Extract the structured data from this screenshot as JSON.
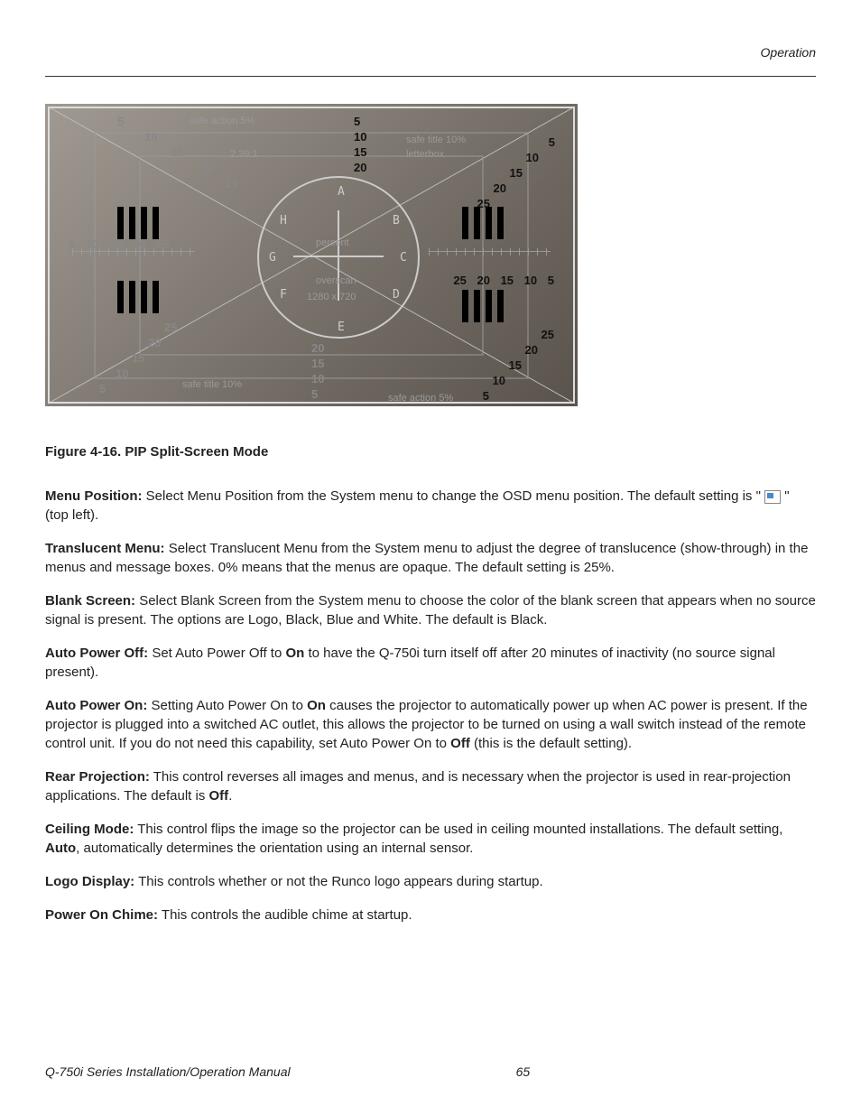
{
  "header": {
    "section": "Operation"
  },
  "figure": {
    "caption": "Figure 4-16. PIP Split-Screen Mode",
    "pattern": {
      "labels": {
        "safe_action_top": "safe action 5%",
        "safe_title_top": "safe title 10%",
        "letterbox": "letterbox",
        "ratio_239": "2.39:1",
        "percent": "percent",
        "overscan": "overscan",
        "resolution": "1280 x 720",
        "safe_title_bottom": "safe title 10%",
        "safe_action_bottom": "safe action 5%"
      },
      "direction_letters": {
        "A": "A",
        "B": "B",
        "C": "C",
        "D": "D",
        "E": "E",
        "F": "F",
        "G": "G",
        "H": "H"
      },
      "scale_top_left": [
        "5",
        "10",
        "15",
        "20",
        "25"
      ],
      "scale_top_center": [
        "5",
        "10",
        "15",
        "20"
      ],
      "scale_top_right": [
        "5",
        "10",
        "15",
        "20",
        "25"
      ],
      "scale_left_h": [
        "5",
        "10",
        "15",
        "20",
        "25"
      ],
      "scale_right_h": [
        "25",
        "20",
        "15",
        "10",
        "5"
      ],
      "scale_bottom_left": [
        "25",
        "20",
        "15",
        "10",
        "5"
      ],
      "scale_bottom_center": [
        "20",
        "15",
        "10",
        "5"
      ],
      "scale_right_mid": [
        "25",
        "20",
        "15",
        "10",
        "5"
      ]
    }
  },
  "p1": {
    "title": "Menu Position:",
    "t1": " Select Menu Position from the System menu to change the OSD menu position. The default setting is \" ",
    "t2": " \" (top left)."
  },
  "p2": {
    "title": "Translucent Menu:",
    "text": " Select Translucent Menu from the System menu to adjust the degree of translucence (show-through) in the menus and message boxes. 0% means that the menus are opaque. The default setting is 25%."
  },
  "p3": {
    "title": "Blank Screen:",
    "text": " Select Blank Screen from the System menu to choose the color of the blank screen that appears when no source signal is present. The options are Logo, Black, Blue and White. The default is Black."
  },
  "p4": {
    "title": "Auto Power Off:",
    "t1": " Set Auto Power Off to ",
    "on": "On",
    "t2": " to have the Q-750i turn itself off after 20 minutes of inactivity (no source signal present)."
  },
  "p5": {
    "title": "Auto Power On:",
    "t1": " Setting Auto Power On to ",
    "on": "On",
    "t2": " causes the projector to automatically power up when AC power is present. If the projector is plugged into a switched AC outlet, this allows the projector to be turned on using a wall switch instead of the remote control unit. If you do not need this capability, set Auto Power On to ",
    "off": "Off",
    "t3": " (this is the default setting)."
  },
  "p6": {
    "title": "Rear Projection:",
    "t1": " This control reverses all images and menus, and is necessary when the projector is used in rear-projection applications.  The default is ",
    "off": "Off",
    "t2": "."
  },
  "p7": {
    "title": "Ceiling Mode:",
    "t1": " This control flips the image so the projector can be used in ceiling mounted installations. The default setting, ",
    "auto": "Auto",
    "t2": ", automatically determines the orientation using an internal sensor."
  },
  "p8": {
    "title": "Logo Display:",
    "text": " This controls whether or not the Runco logo appears during startup."
  },
  "p9": {
    "title": "Power On Chime:",
    "text": " This controls the audible chime at startup."
  },
  "footer": {
    "manual": "Q-750i Series Installation/Operation Manual",
    "page": "65"
  }
}
